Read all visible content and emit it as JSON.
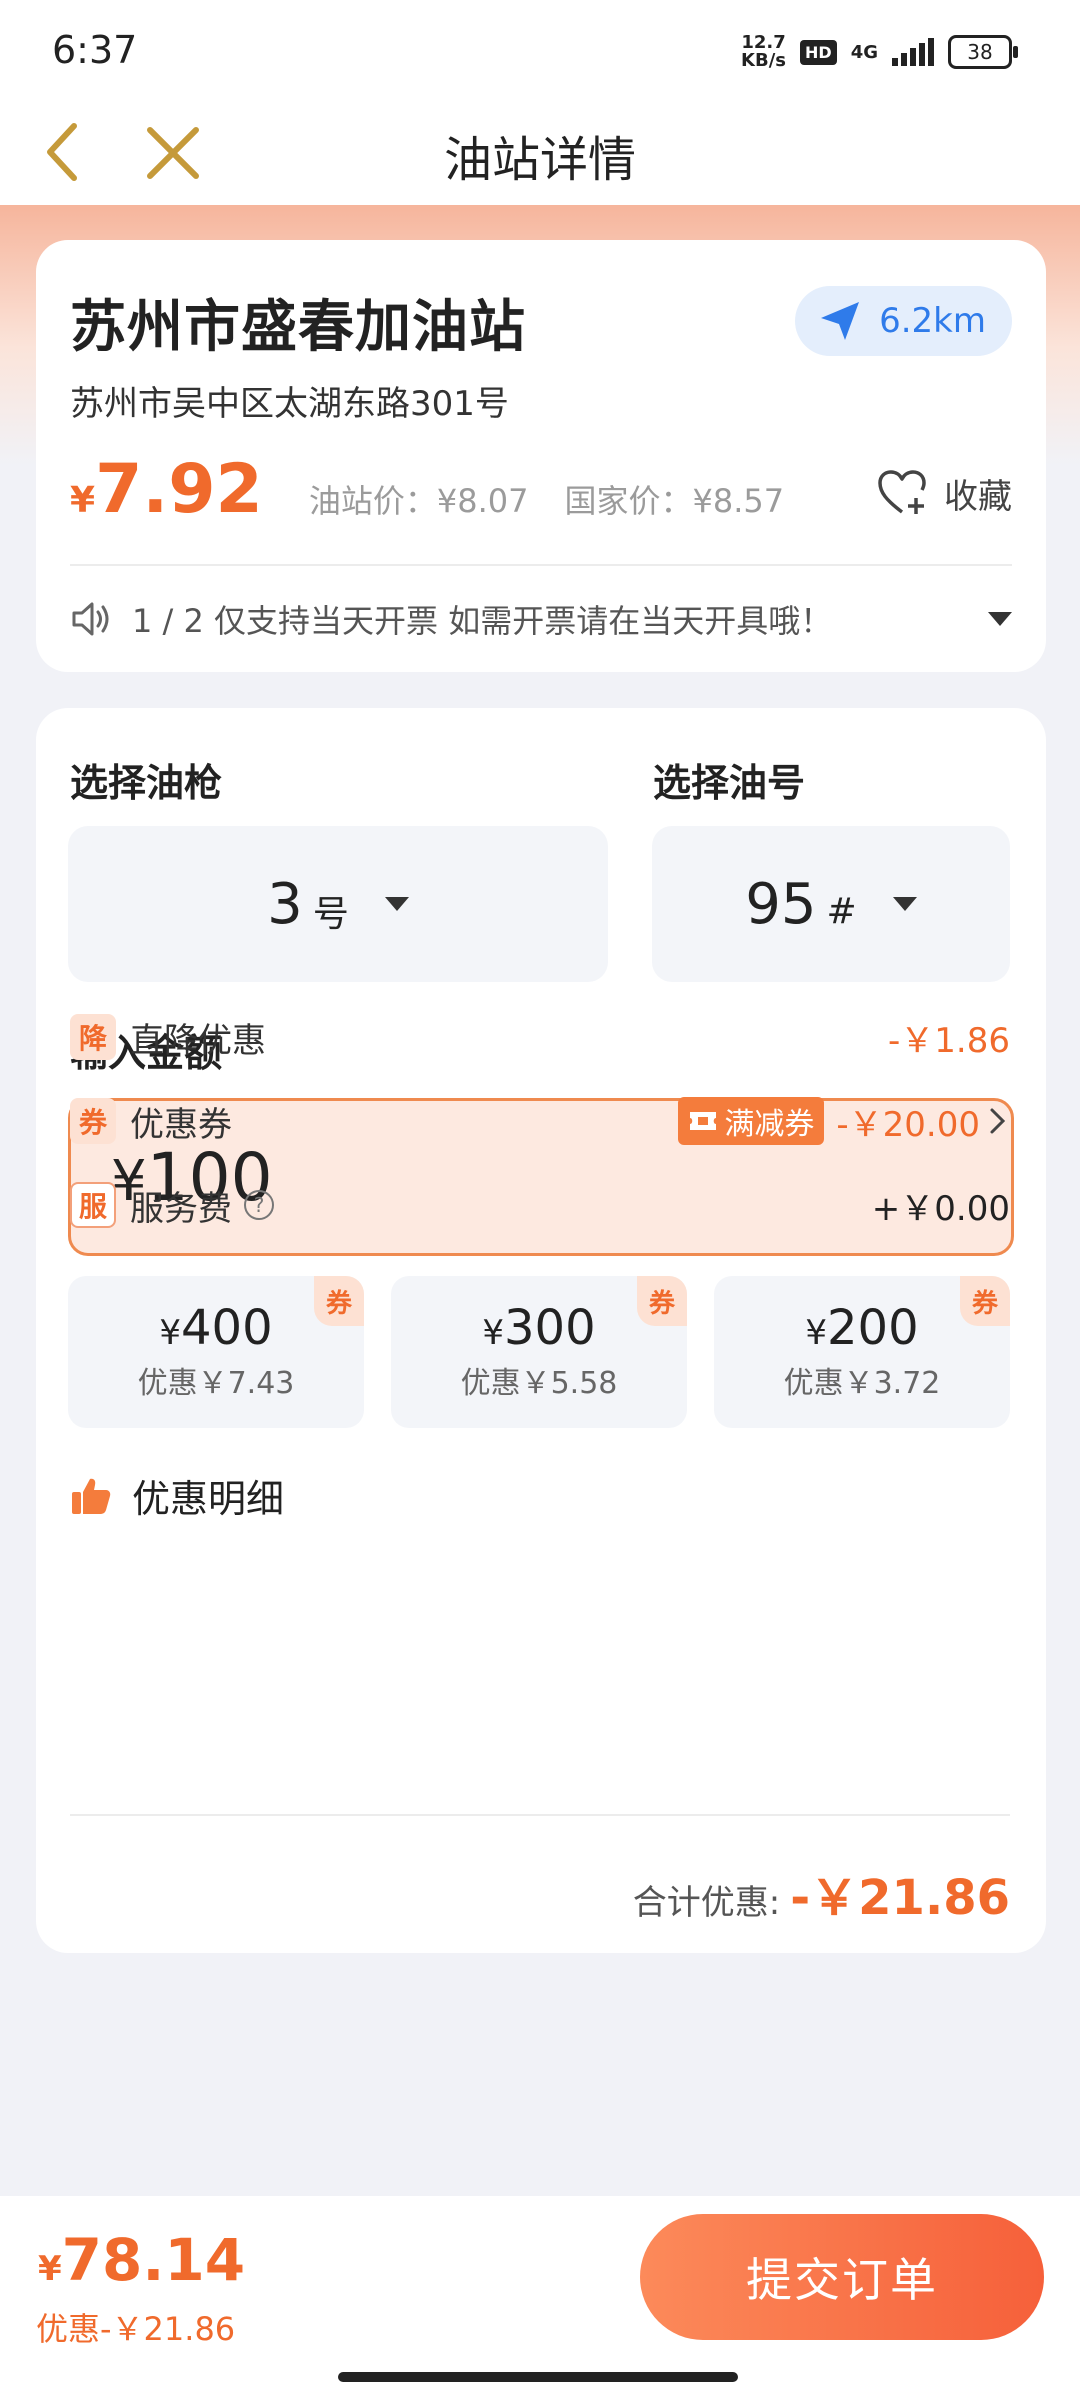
{
  "status_bar": {
    "time": "6:37",
    "speed_top": "12.7",
    "speed_bottom": "KB/s",
    "hd": "HD",
    "network": "4G",
    "battery": "38"
  },
  "nav": {
    "title": "油站详情"
  },
  "station": {
    "name": "苏州市盛春加油站",
    "distance": "6.2km",
    "address": "苏州市吴中区太湖东路301号",
    "price_symbol": "¥",
    "price": "7.92",
    "station_price": "油站价：¥8.07",
    "national_price": "国家价：¥8.57",
    "favorite_label": "收藏",
    "notice": "1 / 2 仅支持当天开票 如需开票请在当天开具哦！"
  },
  "order": {
    "gun_label": "选择油枪",
    "gun_value": "3",
    "gun_unit": "号",
    "oil_label": "选择油号",
    "oil_value": "95",
    "oil_unit": "#",
    "amount_label": "输入金额",
    "amount_symbol": "¥",
    "amount_value": "100",
    "quick_amounts": [
      {
        "symbol": "¥",
        "amount": "400",
        "discount": "优惠￥7.43",
        "tag": "券"
      },
      {
        "symbol": "¥",
        "amount": "300",
        "discount": "优惠￥5.58",
        "tag": "券"
      },
      {
        "symbol": "¥",
        "amount": "200",
        "discount": "优惠￥3.72",
        "tag": "券"
      }
    ]
  },
  "details": {
    "title": "优惠明细",
    "rows": [
      {
        "tag": "降",
        "label": "直降优惠",
        "value": "-￥1.86"
      },
      {
        "tag": "券",
        "label": "优惠券",
        "coupon": "满减券",
        "value": "-￥20.00"
      },
      {
        "tag": "服",
        "label": "服务费",
        "help": "?",
        "value": "+￥0.00"
      }
    ],
    "total_label": "合计优惠:",
    "total_value": "-￥21.86"
  },
  "footer": {
    "pay_symbol": "¥",
    "pay_price": "78.14",
    "discount": "优惠-￥21.86",
    "submit_label": "提交订单"
  },
  "colors": {
    "accent": "#f06a2c",
    "distance_blue": "#2f7bea",
    "amount_border": "#ef8a4f"
  },
  "icons": {
    "back": "chevron-left-icon",
    "close": "close-icon",
    "navigate": "navigation-arrow-icon",
    "favorite": "heart-plus-icon",
    "notice": "speaker-icon",
    "details": "thumbs-up-icon"
  }
}
